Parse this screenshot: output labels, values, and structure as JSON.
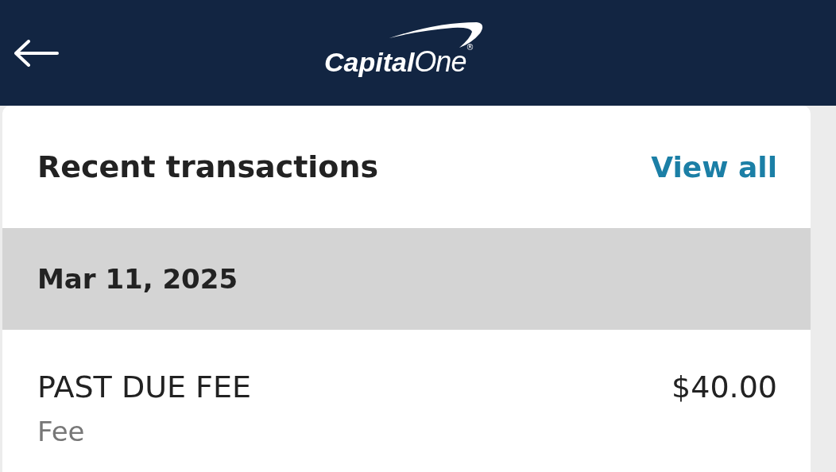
{
  "header": {
    "logo": {
      "word_1": "Capital",
      "word_2": "One",
      "mark": "®"
    }
  },
  "card": {
    "title": "Recent transactions",
    "link": "View all",
    "groups": [
      {
        "date": "Mar 11, 2025",
        "transactions": [
          {
            "name": "PAST DUE FEE",
            "amount": "$40.00",
            "category": "Fee"
          }
        ]
      }
    ]
  }
}
